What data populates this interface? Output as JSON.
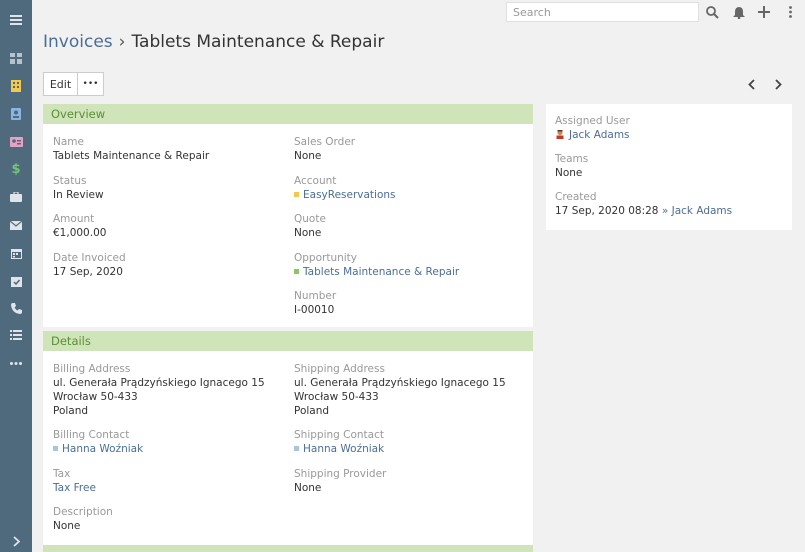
{
  "colors": {
    "nav_bg": "#4f6a7d",
    "accent_link": "#4b6e96",
    "panel_head_bg": "#cfe4b9",
    "panel_head_text": "#5c8e34",
    "nav_icon_home": "#b7c3cc",
    "nav_icon_yellow": "#f2c94c",
    "nav_icon_blue": "#8ab4e4",
    "nav_icon_pink": "#e6a1c4",
    "nav_icon_green": "#71c67a",
    "nav_icon_light": "#dfe5ea"
  },
  "nav": {
    "items": [
      {
        "icon": "menu-icon"
      },
      {
        "icon": "dashboard-icon"
      },
      {
        "icon": "accounts-icon"
      },
      {
        "icon": "contacts-icon"
      },
      {
        "icon": "leads-icon"
      },
      {
        "icon": "dollar-icon"
      },
      {
        "icon": "briefcase-icon"
      },
      {
        "icon": "email-icon"
      },
      {
        "icon": "calendar-icon"
      },
      {
        "icon": "tasks-icon"
      },
      {
        "icon": "phone-icon"
      },
      {
        "icon": "list-icon"
      },
      {
        "icon": "more-icon"
      },
      {
        "icon": "expand-icon"
      }
    ]
  },
  "topbar": {
    "search_placeholder": "Search",
    "icons": [
      "search-icon",
      "bell-icon",
      "plus-icon",
      "kebab-icon"
    ]
  },
  "header": {
    "breadcrumb_module": "Invoices",
    "separator": "›",
    "record_name": "Tablets Maintenance & Repair"
  },
  "actions": {
    "edit_label": "Edit",
    "more_label": "•••"
  },
  "overview": {
    "title": "Overview",
    "name_label": "Name",
    "name_value": "Tablets Maintenance & Repair",
    "status_label": "Status",
    "status_value": "In Review",
    "amount_label": "Amount",
    "amount_value": "€1,000.00",
    "date_label": "Date Invoiced",
    "date_value": "17 Sep, 2020",
    "sales_order_label": "Sales Order",
    "sales_order_value": "None",
    "account_label": "Account",
    "account_value": "EasyReservations",
    "account_color": "#f2c94c",
    "quote_label": "Quote",
    "quote_value": "None",
    "opportunity_label": "Opportunity",
    "opportunity_value": "Tablets Maintenance & Repair",
    "opportunity_color": "#8cc36c",
    "number_label": "Number",
    "number_value": "I-00010"
  },
  "details": {
    "title": "Details",
    "billing_address_label": "Billing Address",
    "billing_address_lines": [
      "ul. Generała Prądzyńskiego Ignacego 15",
      "Wrocław 50-433",
      "Poland"
    ],
    "shipping_address_label": "Shipping Address",
    "shipping_address_lines": [
      "ul. Generała Prądzyńskiego Ignacego 15",
      "Wrocław 50-433",
      "Poland"
    ],
    "billing_contact_label": "Billing Contact",
    "billing_contact_value": "Hanna Woźniak",
    "shipping_contact_label": "Shipping Contact",
    "shipping_contact_value": "Hanna Woźniak",
    "contact_color": "#a9c4df",
    "tax_label": "Tax",
    "tax_value": "Tax Free",
    "shipping_provider_label": "Shipping Provider",
    "shipping_provider_value": "None",
    "description_label": "Description",
    "description_value": "None"
  },
  "side": {
    "assigned_user_label": "Assigned User",
    "assigned_user_value": "Jack Adams",
    "teams_label": "Teams",
    "teams_value": "None",
    "created_label": "Created",
    "created_date": "17 Sep, 2020 08:28",
    "created_sep": "»",
    "created_by": "Jack Adams"
  }
}
